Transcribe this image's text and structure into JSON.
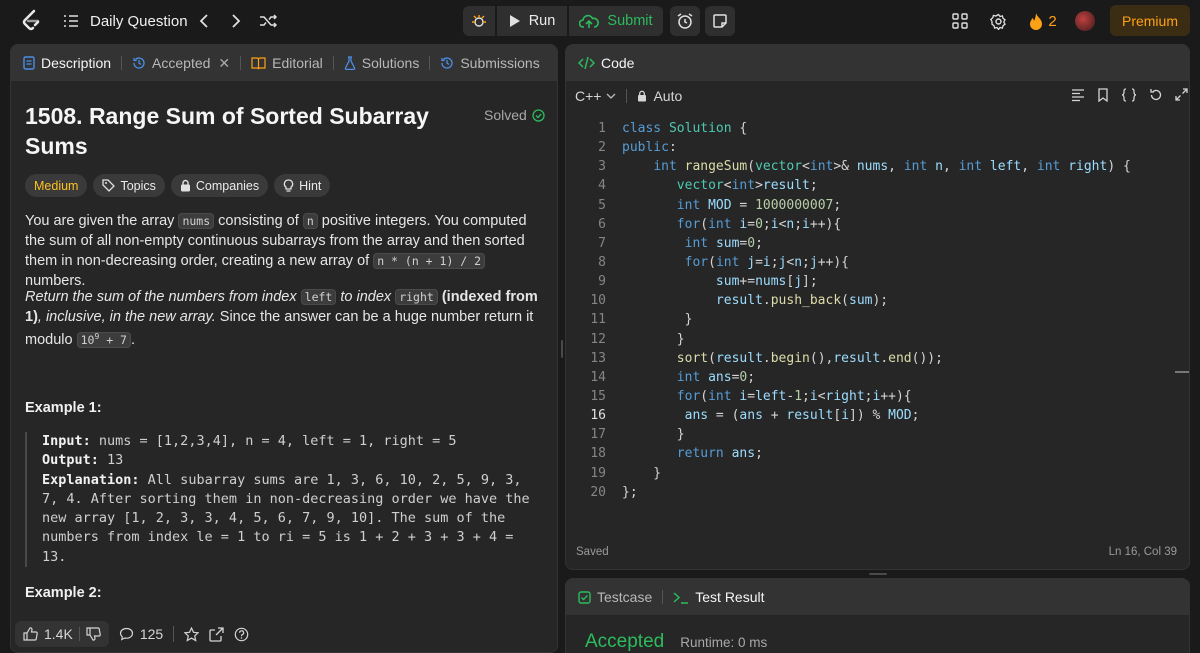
{
  "topbar": {
    "daily_question": "Daily Question",
    "run": "Run",
    "submit": "Submit",
    "streak": "2",
    "premium": "Premium"
  },
  "description_panel": {
    "tabs": [
      "Description",
      "Accepted",
      "Editorial",
      "Solutions",
      "Submissions"
    ],
    "title": "1508. Range Sum of Sorted Subarray Sums",
    "status": "Solved",
    "chips": [
      "Medium",
      "Topics",
      "Companies",
      "Hint"
    ],
    "para1": {
      "t1": "You are given the array ",
      "c1": "nums",
      "t2": " consisting of ",
      "c2": "n",
      "t3": " positive integers. You computed the sum of all non-empty continuous subarrays from the array and then sorted them in non-decreasing order, creating a new array of ",
      "c3": "n * (n + 1) / 2",
      "t4": " numbers."
    },
    "para2": {
      "i1": "Return the sum of the numbers from index ",
      "c1": "left",
      "i2": " to index ",
      "c2": "right",
      "b1": " (indexed from 1)",
      "i3": ", inclusive, in the new array.",
      "t1": " Since the answer can be a huge number return it modulo ",
      "c3_base": "10",
      "c3_exp": "9",
      "c3_rest": " + 7",
      "t2": "."
    },
    "example1": {
      "heading": "Example 1:",
      "input_label": "Input:",
      "input": " nums = [1,2,3,4], n = 4, left = 1, right = 5",
      "output_label": "Output:",
      "output": " 13",
      "explanation_label": "Explanation:",
      "explanation": " All subarray sums are 1, 3, 6, 10, 2, 5, 9, 3, 7, 4. After sorting them in non-decreasing order we have the new array [1, 2, 3, 3, 4, 5, 6, 7, 9, 10]. The sum of the numbers from index le = 1 to ri = 5 is 1 + 2 + 3 + 3 + 4 = 13."
    },
    "example2_heading": "Example 2:",
    "footer": {
      "likes": "1.4K",
      "comments": "125"
    }
  },
  "code_panel": {
    "title": "Code",
    "language": "C++",
    "mode": "Auto",
    "saved": "Saved",
    "cursor": "Ln 16, Col 39",
    "current_line": 16,
    "line_numbers": [
      "1",
      "2",
      "3",
      "4",
      "5",
      "6",
      "7",
      "8",
      "9",
      "10",
      "11",
      "12",
      "13",
      "14",
      "15",
      "16",
      "17",
      "18",
      "19",
      "20"
    ]
  },
  "test_panel": {
    "tabs": [
      "Testcase",
      "Test Result"
    ],
    "result": "Accepted",
    "runtime": "Runtime: 0 ms"
  },
  "colors": {
    "accent_orange": "#ffa116",
    "accepted_green": "#2cbb5d",
    "medium_yellow": "#ffc01e",
    "panel_bg": "#262626"
  }
}
